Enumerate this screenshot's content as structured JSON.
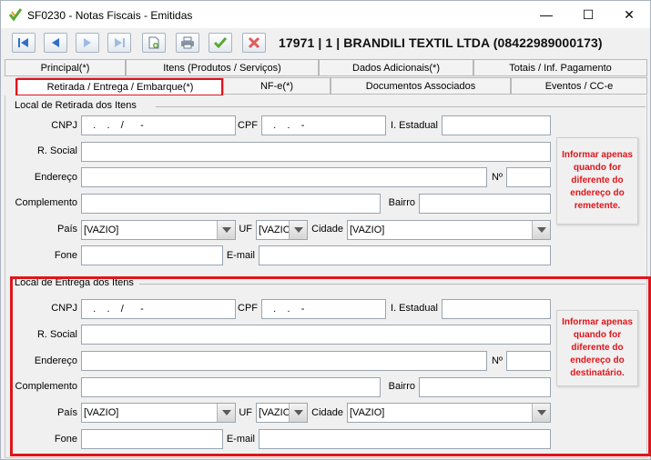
{
  "window": {
    "title": "SF0230 - Notas Fiscais - Emitidas",
    "minimize": "—",
    "maximize": "☐",
    "close": "✕"
  },
  "toolbar": {
    "record_info": "17971  |  1  |  BRANDILI TEXTIL LTDA (08422989000173)",
    "icons": [
      "first-record-icon",
      "previous-record-icon",
      "next-record-icon",
      "last-record-icon",
      "new-record-icon",
      "print-icon",
      "confirm-check-icon",
      "cancel-x-icon"
    ]
  },
  "tabs": {
    "row1": [
      "Principal(*)",
      "Itens (Produtos / Serviços)",
      "Dados Adicionais(*)",
      "Totais / Inf. Pagamento"
    ],
    "row2": [
      "Retirada / Entrega / Embarque(*)",
      "NF-e(*)",
      "Documentos Associados",
      "Eventos / CC-e"
    ]
  },
  "retirada": {
    "title": "Local de Retirada dos Itens",
    "labels": {
      "cnpj": "CNPJ",
      "cpf": "CPF",
      "ie": "I. Estadual",
      "razao": "R. Social",
      "endereco": "Endereço",
      "numero": "Nº",
      "complemento": "Complemento",
      "bairro": "Bairro",
      "pais": "País",
      "uf": "UF",
      "cidade": "Cidade",
      "fone": "Fone",
      "email": "E-mail"
    },
    "values": {
      "cnpj": "   .    .    /      -",
      "cpf": "   .    .    -",
      "ie": "",
      "razao": "",
      "endereco": "",
      "numero": "",
      "complemento": "",
      "bairro": "",
      "pais": "[VAZIO]",
      "uf": "[VAZIO]",
      "cidade": "[VAZIO]",
      "fone": "",
      "email": ""
    },
    "note": "Informar apenas quando for diferente do endereço do remetente."
  },
  "entrega": {
    "title": "Local de Entrega dos Itens",
    "labels": {
      "cnpj": "CNPJ",
      "cpf": "CPF",
      "ie": "I. Estadual",
      "razao": "R. Social",
      "endereco": "Endereço",
      "numero": "Nº",
      "complemento": "Complemento",
      "bairro": "Bairro",
      "pais": "País",
      "uf": "UF",
      "cidade": "Cidade",
      "fone": "Fone",
      "email": "E-mail"
    },
    "values": {
      "cnpj": "   .    .    /      -",
      "cpf": "   .    .    -",
      "ie": "",
      "razao": "",
      "endereco": "",
      "numero": "",
      "complemento": "",
      "bairro": "",
      "pais": "[VAZIO]",
      "uf": "[VAZIO]",
      "cidade": "[VAZIO]",
      "fone": "",
      "email": ""
    },
    "note": "Informar apenas quando for diferente do endereço do destinatário."
  },
  "colors": {
    "highlight": "#e0151b",
    "nav_blue": "#2f6fc7",
    "confirm_green": "#5aa832",
    "cancel_red": "#e05a5a"
  }
}
